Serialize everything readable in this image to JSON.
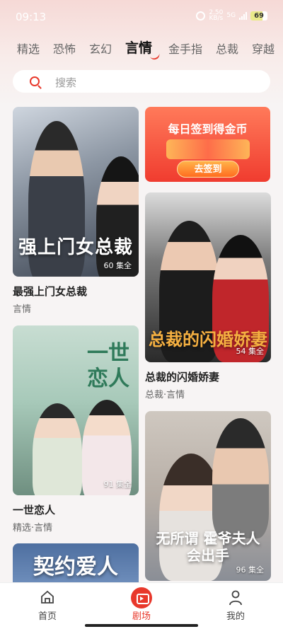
{
  "status_bar": {
    "time": "09:13",
    "net_speed_value": "2.50",
    "net_speed_unit": "KB/s",
    "network": "5G",
    "battery": "69"
  },
  "tabs": [
    "精选",
    "恐怖",
    "玄幻",
    "言情",
    "金手指",
    "总裁",
    "穿越"
  ],
  "active_tab": "言情",
  "search": {
    "placeholder": "搜索"
  },
  "banner": {
    "title": "每日签到得金币",
    "button": "去签到"
  },
  "dramas": [
    {
      "poster_title": "强上门女总裁",
      "episodes": "60 集全",
      "title": "最强上门女总裁",
      "tags": "言情"
    },
    {
      "poster_title": "一世恋人",
      "episodes": "91 集全",
      "title": "一世恋人",
      "tags": "精选·言情"
    },
    {
      "poster_title": "契约爱人",
      "episodes": "",
      "title": "",
      "tags": ""
    },
    {
      "poster_title": "总裁的闪婚娇妻",
      "episodes": "54 集全",
      "title": "总裁的闪婚娇妻",
      "tags": "总裁·言情"
    },
    {
      "poster_title": "无所谓 霍爷夫人会出手",
      "episodes": "96 集全",
      "title": "",
      "tags": ""
    }
  ],
  "bottom_nav": {
    "home": "首页",
    "theater": "剧场",
    "me": "我的"
  },
  "colors": {
    "accent": "#e8382b",
    "background": "#f7f4f4"
  }
}
